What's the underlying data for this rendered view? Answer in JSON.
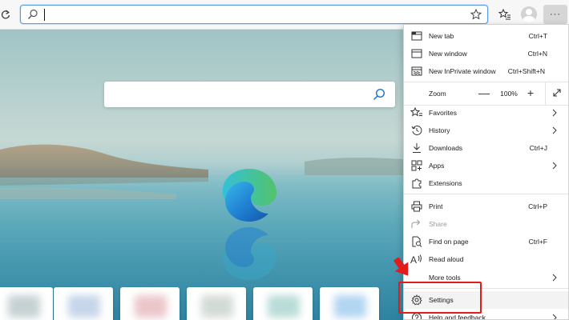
{
  "address_bar": {
    "value": "",
    "placeholder": ""
  },
  "toolbar": {
    "refresh_icon": "refresh-icon",
    "favorite_icon": "star-icon",
    "collections_icon": "favorites-list-icon",
    "profile_icon": "avatar",
    "more_icon": "ellipsis-icon",
    "more_label": "···"
  },
  "menu": {
    "new_tab": {
      "label": "New tab",
      "shortcut": "Ctrl+T"
    },
    "new_window": {
      "label": "New window",
      "shortcut": "Ctrl+N"
    },
    "new_inprivate": {
      "label": "New InPrivate window",
      "shortcut": "Ctrl+Shift+N"
    },
    "zoom": {
      "label": "Zoom",
      "minus": "—",
      "value": "100%",
      "plus": "+"
    },
    "favorites": {
      "label": "Favorites"
    },
    "history": {
      "label": "History"
    },
    "downloads": {
      "label": "Downloads",
      "shortcut": "Ctrl+J"
    },
    "apps": {
      "label": "Apps"
    },
    "extensions": {
      "label": "Extensions"
    },
    "print": {
      "label": "Print",
      "shortcut": "Ctrl+P"
    },
    "share": {
      "label": "Share"
    },
    "find": {
      "label": "Find on page",
      "shortcut": "Ctrl+F"
    },
    "read_aloud": {
      "label": "Read aloud"
    },
    "more_tools": {
      "label": "More tools"
    },
    "settings": {
      "label": "Settings"
    },
    "help": {
      "label": "Help and feedback"
    }
  },
  "colors": {
    "highlight": "#e21b1b",
    "address_focus": "#5a9be8",
    "edge_blue": "#1f7fd2",
    "edge_green": "#52c36a"
  }
}
